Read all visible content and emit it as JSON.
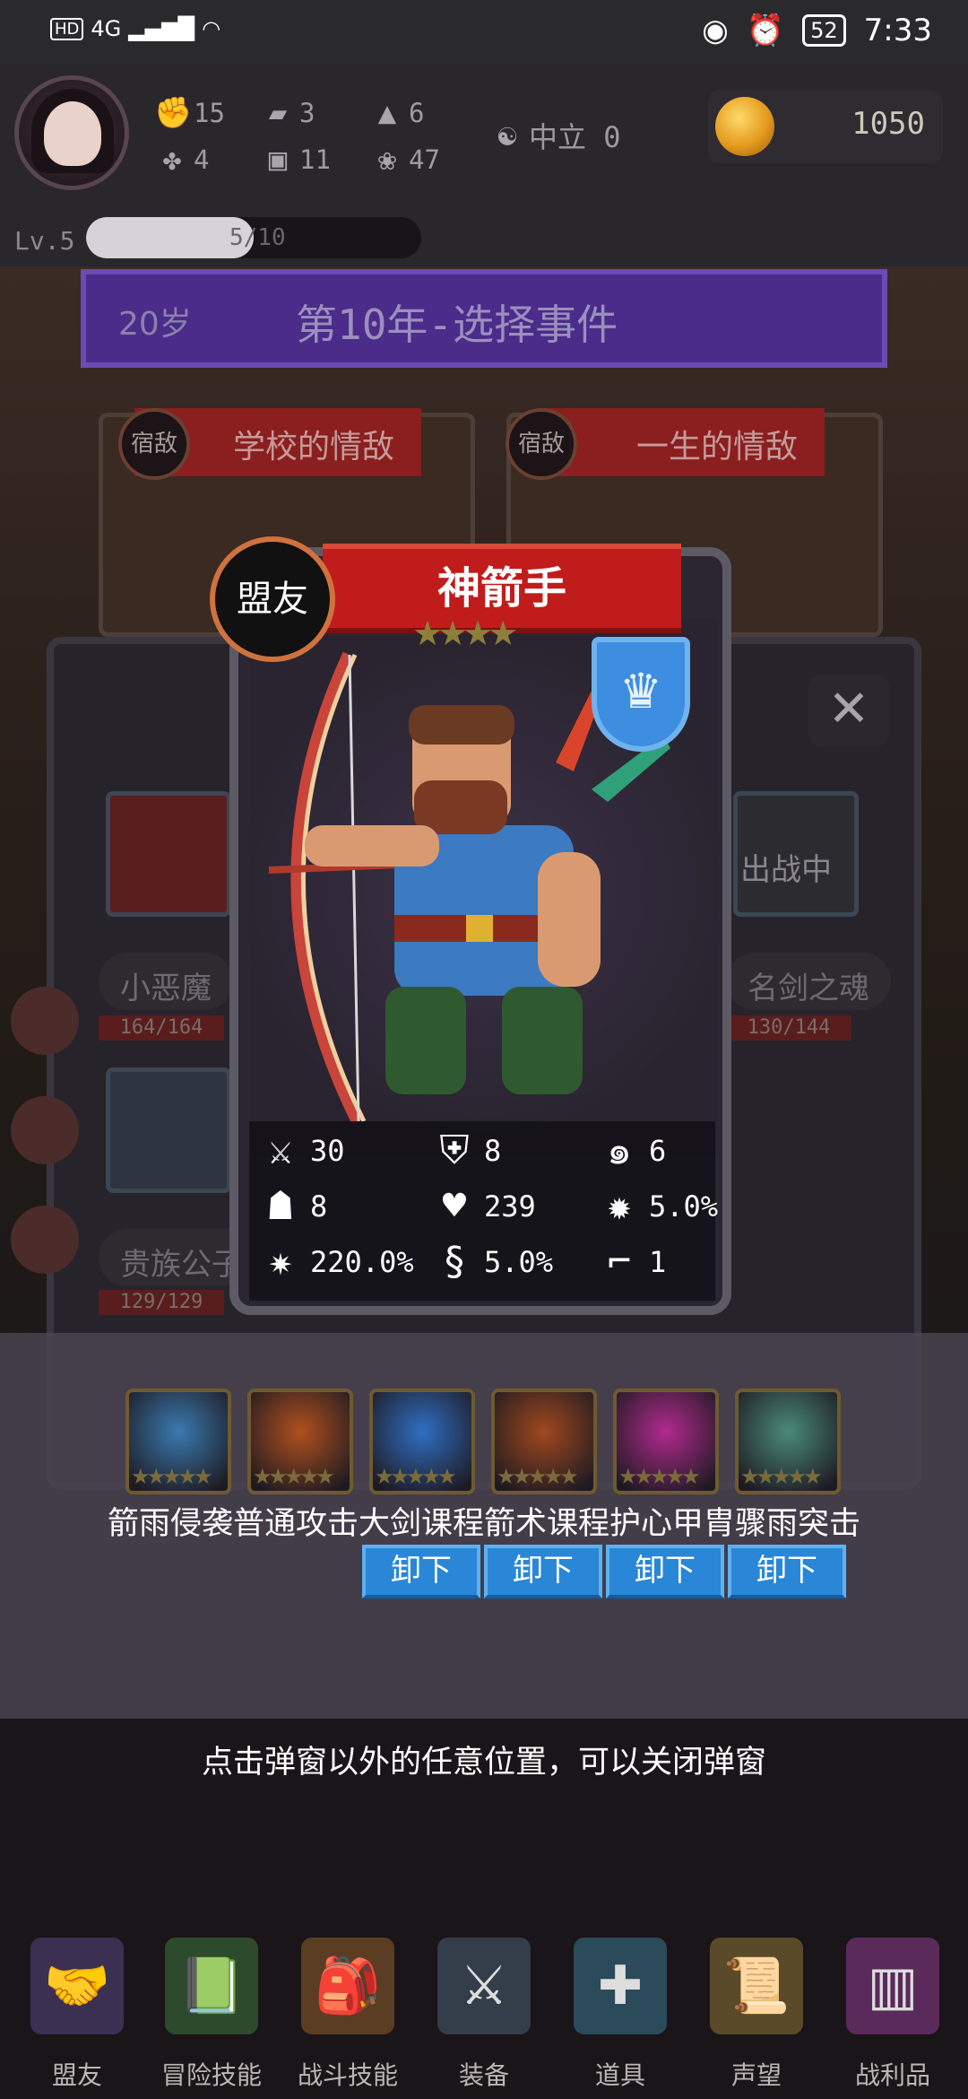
{
  "status_bar": {
    "network": "4G",
    "battery": "52",
    "time": "7:33"
  },
  "player": {
    "stats": [
      {
        "icon": "fist-icon",
        "value": "15"
      },
      {
        "icon": "boot-icon",
        "value": "3"
      },
      {
        "icon": "wizard-hat-icon",
        "value": "6"
      },
      {
        "icon": "clover-icon",
        "value": "4"
      },
      {
        "icon": "book-icon",
        "value": "11"
      },
      {
        "icon": "lotus-icon",
        "value": "47"
      }
    ],
    "alignment": "中立 0",
    "gold": "1050",
    "level": "Lv.5",
    "xp_text": "5/10",
    "xp_fraction": 0.5
  },
  "event": {
    "age": "20岁",
    "title": "第10年-选择事件",
    "options": [
      {
        "badge": "宿敌",
        "title": "学校的情敌"
      },
      {
        "badge": "宿敌",
        "title": "一生的情敌"
      }
    ]
  },
  "background_panel": {
    "allies": [
      {
        "name": "小恶魔",
        "hp": "164/164"
      },
      {
        "name": "名剑之魂",
        "hp": "130/144",
        "status": "出战中"
      },
      {
        "name": "贵族公子",
        "hp": "129/129"
      }
    ],
    "close_symbol": "✕"
  },
  "ally_card": {
    "badge": "盟友",
    "name": "神箭手",
    "stars": 4,
    "stats": [
      {
        "icon": "sword-icon",
        "value": "30"
      },
      {
        "icon": "shield-icon",
        "value": "8"
      },
      {
        "icon": "tornado-swirl-icon",
        "value": "6"
      },
      {
        "icon": "hood-icon",
        "value": "8"
      },
      {
        "icon": "heart-icon",
        "value": "239"
      },
      {
        "icon": "burst-icon",
        "value": "5.0%"
      },
      {
        "icon": "crit-splash-icon",
        "value": "220.0%"
      },
      {
        "icon": "whirlwind-icon",
        "value": "5.0%"
      },
      {
        "icon": "boot-icon",
        "value": "1"
      }
    ]
  },
  "skills": {
    "names_line": "箭雨侵袭普通攻击大剑课程箭术课程护心甲胄骤雨突击",
    "icons": [
      {
        "name": "arrow-rain",
        "color": "#3a7ab0"
      },
      {
        "name": "normal-attack",
        "color": "#b0501e"
      },
      {
        "name": "greatsword",
        "color": "#2f6fc2"
      },
      {
        "name": "archery",
        "color": "#a0481e"
      },
      {
        "name": "heart-armor",
        "color": "#b02a8e"
      },
      {
        "name": "storm-strike",
        "color": "#4a8a7a"
      }
    ],
    "unequip_label": "卸下"
  },
  "hint": "点击弹窗以外的任意位置，可以关闭弹窗",
  "nav": [
    {
      "label": "盟友",
      "icon": "handshake-icon",
      "color": "#3b2f52"
    },
    {
      "label": "冒险技能",
      "icon": "spellbook-icon",
      "color": "#2e4a2c"
    },
    {
      "label": "战斗技能",
      "icon": "backpack-icon",
      "color": "#5a3d22"
    },
    {
      "label": "装备",
      "icon": "crossed-swords-icon",
      "color": "#343d4a"
    },
    {
      "label": "道具",
      "icon": "pouch-icon",
      "color": "#2b4a5a"
    },
    {
      "label": "声望",
      "icon": "scroll-icon",
      "color": "#5a4a2a"
    },
    {
      "label": "战利品",
      "icon": "treasure-chest-icon",
      "color": "#5a2a5a"
    }
  ]
}
